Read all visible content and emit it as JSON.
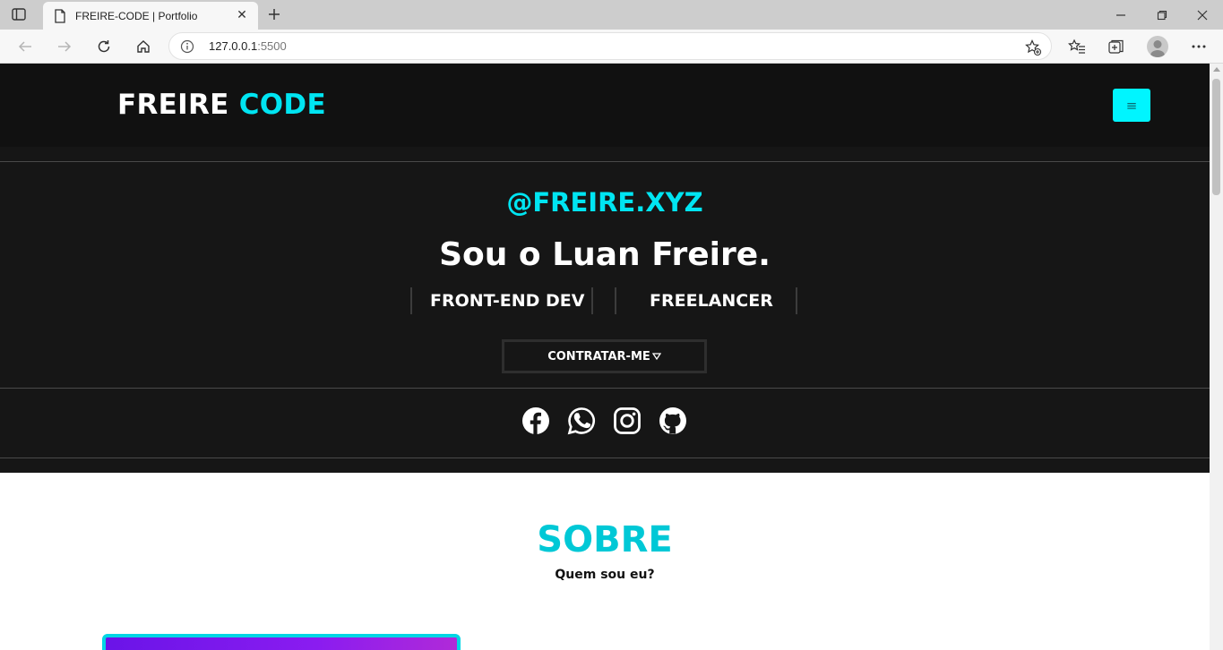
{
  "browser": {
    "tab_title": "FREIRE-CODE | Portfolio",
    "url_host": "127.0.0.1",
    "url_port": ":5500"
  },
  "site": {
    "logo_main": "FREIRE",
    "logo_accent": "CODE",
    "menu_glyph": "≡",
    "handle": "@FREIRE.XYZ",
    "headline": "Sou o Luan Freire.",
    "roles": [
      "FRONT-END DEV",
      "FREELANCER"
    ],
    "cta_label": "CONTRATAR-ME",
    "socials": [
      "facebook-icon",
      "whatsapp-icon",
      "instagram-icon",
      "github-icon"
    ],
    "about_title": "SOBRE",
    "about_subtitle": "Quem sou eu?"
  },
  "colors": {
    "accent": "#00e5f2",
    "header_bg": "#111111",
    "hero_bg": "#161616"
  }
}
